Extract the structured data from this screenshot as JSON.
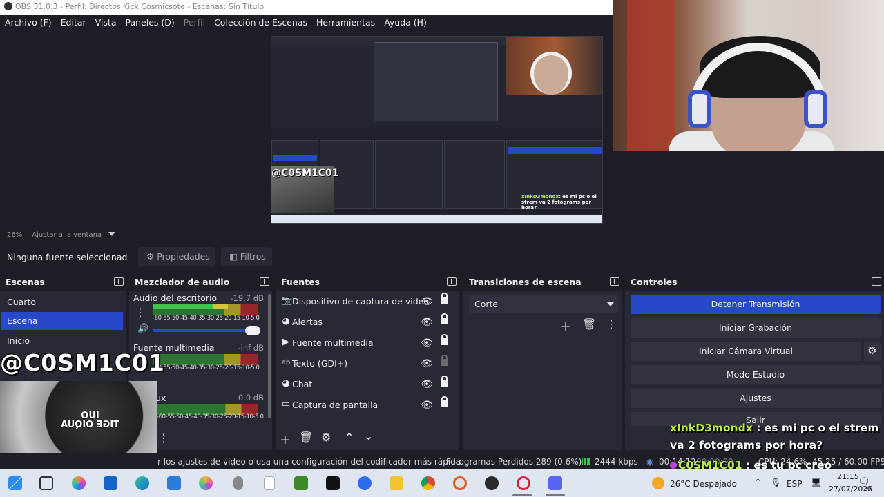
{
  "title": "OBS 31.0.3 - Perfil: Directos Kick Cosmicsote - Escenas: Sin Título",
  "menu": [
    "Archivo (F)",
    "Editar",
    "Vista",
    "Paneles (D)",
    "Perfil",
    "Colección de Escenas",
    "Herramientas",
    "Ayuda (H)"
  ],
  "zoom": {
    "percent": "26%",
    "fit": "Ajustar a la ventana"
  },
  "propbar": {
    "no_source": "Ninguna fuente seleccionad",
    "properties": "Propiedades",
    "filters": "Filtros"
  },
  "scenes": {
    "title": "Escenas",
    "items": [
      "Cuarto",
      "Escena",
      "Inicio"
    ],
    "selected_index": 1
  },
  "mixer": {
    "title": "Mezclador de audio",
    "channels": [
      {
        "name": "Audio del escritorio",
        "db": "-19.7 dB",
        "level": 0.72
      },
      {
        "name": "Fuente multimedia",
        "db": "-inf dB",
        "level": 0.0
      },
      {
        "name": "Mic/Aux",
        "db": "0.0 dB",
        "level": 0.0
      }
    ],
    "ticks": "-60-55-50-45-40-35-30-25-20-15-10-5 0"
  },
  "sources": {
    "title": "Fuentes",
    "items": [
      {
        "icon": "video-capture-icon",
        "name": "Dispositivo de captura de video",
        "locked": true
      },
      {
        "icon": "browser-icon",
        "name": "Alertas",
        "locked": true
      },
      {
        "icon": "play-icon",
        "name": "Fuente multimedia",
        "locked": true
      },
      {
        "icon": "text-icon",
        "name": "Texto (GDI+)",
        "locked": false
      },
      {
        "icon": "browser-icon",
        "name": "Chat",
        "locked": true
      },
      {
        "icon": "monitor-icon",
        "name": "Captura de pantalla",
        "locked": true
      }
    ]
  },
  "transitions": {
    "title": "Transiciones de escena",
    "selected": "Corte"
  },
  "controls": {
    "title": "Controles",
    "buttons": [
      "Detener Transmisión",
      "Iniciar Grabación",
      "Iniciar Cámara Virtual",
      "Modo Estudio",
      "Ajustes",
      "Salir"
    ]
  },
  "overlay": {
    "handle": "@C0SM1C01",
    "monkey_text": "IUO\nTIGE OIQUA",
    "chat": [
      {
        "user": "xInkD3mondx",
        "message": " : es mi pc o el strem va 2 fotograms por hora?"
      },
      {
        "user": "C0SM1C01",
        "message": " : es tu pc creo"
      }
    ],
    "preview_handle": "@C0SM1C01",
    "preview_chat_user": "xInkD3mondx",
    "preview_chat_msg": ": es mi pc o el strem va 2 fotograms por hora?"
  },
  "status": {
    "hint": "r los ajustes de video o usa una configuración del codificador más rápida",
    "dropped": "Fotogramas Perdidos 289 (0.6%)",
    "bitrate": "2444 kbps",
    "live_time": "00:14:12",
    "rec_time": "00:00:00",
    "cpu": "CPU: 24.6%",
    "fps": "45.25 / 60.00 FPS"
  },
  "taskbar": {
    "weather": "26°C Despejado",
    "lang": "ESP",
    "time": "21:15",
    "date": "27/07/2025",
    "notif": "20",
    "icons": [
      "windows-icon",
      "task-view-icon",
      "copilot-icon",
      "outlook-icon",
      "edge-icon",
      "store-icon",
      "copilot-m365-icon",
      "mouse-app-icon",
      "notepad-icon",
      "minecraft-icon",
      "capcut-icon",
      "zoom-icon",
      "file-explorer-icon",
      "chrome-icon",
      "paint-icon",
      "obs-icon",
      "opera-icon",
      "discord-icon"
    ]
  },
  "colors": {
    "accent": "#2549c8",
    "dock_bg": "#272934",
    "window_bg": "#1e1f26",
    "chat_user": "#b7f040"
  }
}
